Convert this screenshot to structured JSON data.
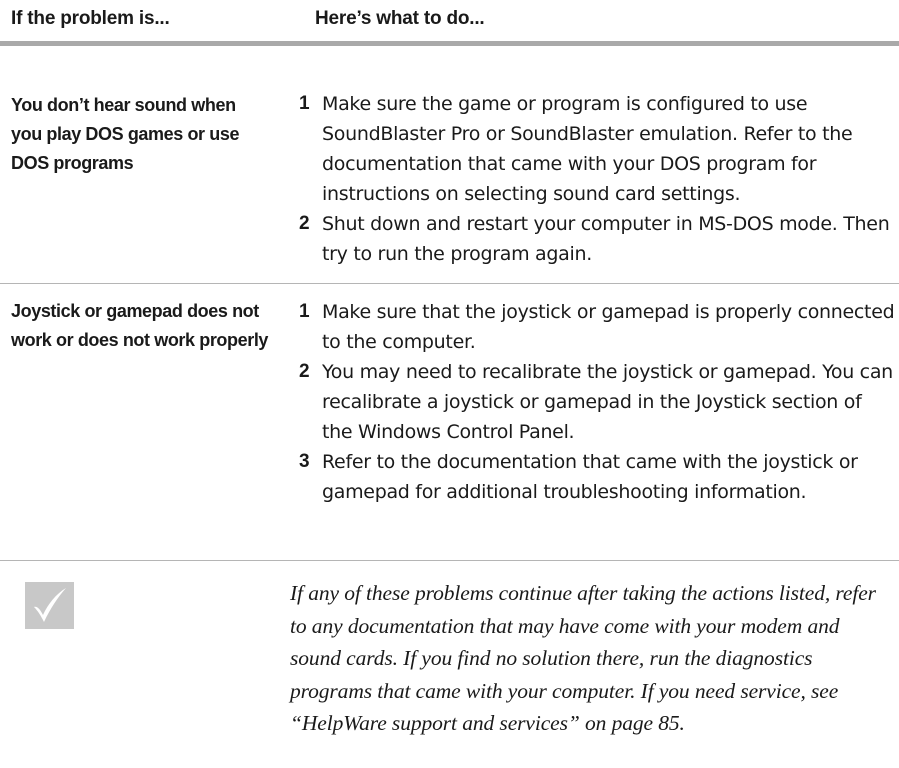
{
  "header": {
    "col_problem": "If the problem is...",
    "col_action": "Here’s what to do..."
  },
  "rows": [
    {
      "problem": "You don’t hear sound when you play DOS games or use DOS programs",
      "steps": [
        {
          "num": "1",
          "text": "Make sure the game or program is configured to use SoundBlaster Pro or SoundBlaster emulation. Refer to the documentation that came with your DOS program for instructions on selecting sound card settings."
        },
        {
          "num": "2",
          "text": "Shut down and restart your computer in MS-DOS mode. Then try to run the program again."
        }
      ]
    },
    {
      "problem": "Joystick or gamepad does not work or does not work properly",
      "steps": [
        {
          "num": "1",
          "text": "Make sure that the joystick or gamepad is properly connected to the computer."
        },
        {
          "num": "2",
          "text": "You may need to recalibrate the joystick or gamepad. You can recalibrate a joystick or gamepad in the Joystick section of the Windows Control Panel."
        },
        {
          "num": "3",
          "text": "Refer to the documentation that came with the joystick or gamepad for additional troubleshooting information."
        }
      ]
    }
  ],
  "note": {
    "icon": "checkmark-icon",
    "text": "If any of these problems continue after taking the actions listed, refer to any documentation that may have come with your modem and sound cards. If you find no solution there, run the diagnostics programs that came with your computer. If you need service, see “HelpWare support and services” on page 85."
  },
  "colors": {
    "thick_rule": "#a9a9a9",
    "thin_rule": "#b5b5b5",
    "icon_box": "#c8c8c8",
    "icon_check": "#ffffff"
  }
}
